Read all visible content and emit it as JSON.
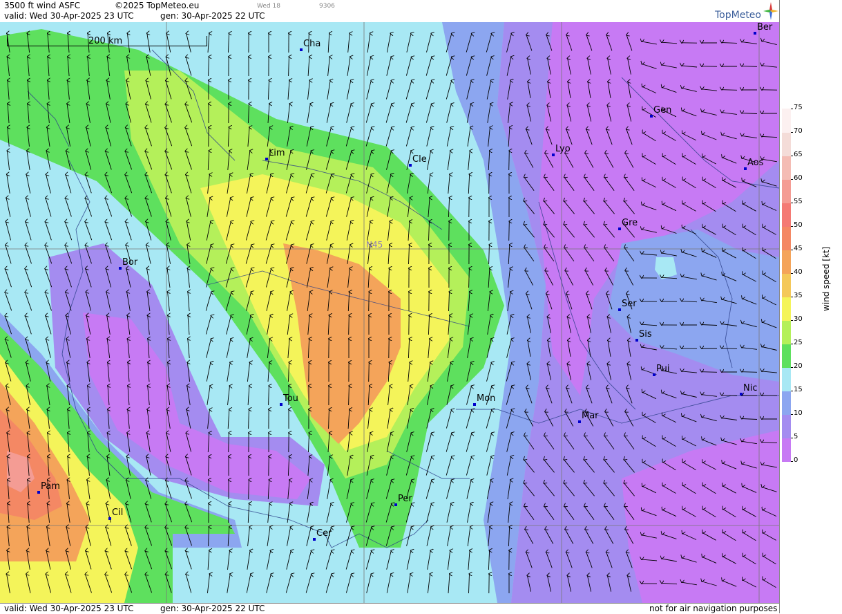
{
  "header": {
    "title": "3500 ft wind ASFC",
    "copyright": "©2025 TopMeteo.eu",
    "valid": "valid:  Wed  30-Apr-2025  23 UTC",
    "gen": "gen: 30-Apr-2025 22 UTC",
    "sub1": "Wed 18",
    "sub2": "9306"
  },
  "brand": {
    "name": "TopMeteo"
  },
  "scale_bar": {
    "label": "200 km"
  },
  "grid_label": "N45",
  "footer": {
    "valid": "valid:  Wed  30-Apr-2025  23 UTC",
    "gen": "gen: 30-Apr-2025 22 UTC",
    "notice": "not for air navigation purposes"
  },
  "legend": {
    "title": "wind speed [kt]",
    "ticks": [
      "0",
      "5",
      "10",
      "15",
      "20",
      "25",
      "30",
      "35",
      "40",
      "45",
      "50",
      "55",
      "60",
      "65",
      "70",
      "75"
    ],
    "colors": [
      "#c77af4",
      "#a48cf0",
      "#8ca6f0",
      "#a8e8f4",
      "#5ee05e",
      "#b4f05a",
      "#f4f45a",
      "#f4c85a",
      "#f4a45a",
      "#f48864",
      "#f47a74",
      "#f49c94",
      "#f4bcb4",
      "#f4dcd8",
      "#fcf0f0"
    ]
  },
  "cities": [
    {
      "name": "Cha"
    },
    {
      "name": "Ber"
    },
    {
      "name": "Gen"
    },
    {
      "name": "Lim"
    },
    {
      "name": "Cle"
    },
    {
      "name": "Lyo"
    },
    {
      "name": "Aos"
    },
    {
      "name": "Gre"
    },
    {
      "name": "Bor"
    },
    {
      "name": "Ser"
    },
    {
      "name": "Sis"
    },
    {
      "name": "Pui"
    },
    {
      "name": "Tou"
    },
    {
      "name": "Mon"
    },
    {
      "name": "Nic"
    },
    {
      "name": "Mar"
    },
    {
      "name": "Pam"
    },
    {
      "name": "Cil"
    },
    {
      "name": "Per"
    },
    {
      "name": "Cer"
    }
  ]
}
